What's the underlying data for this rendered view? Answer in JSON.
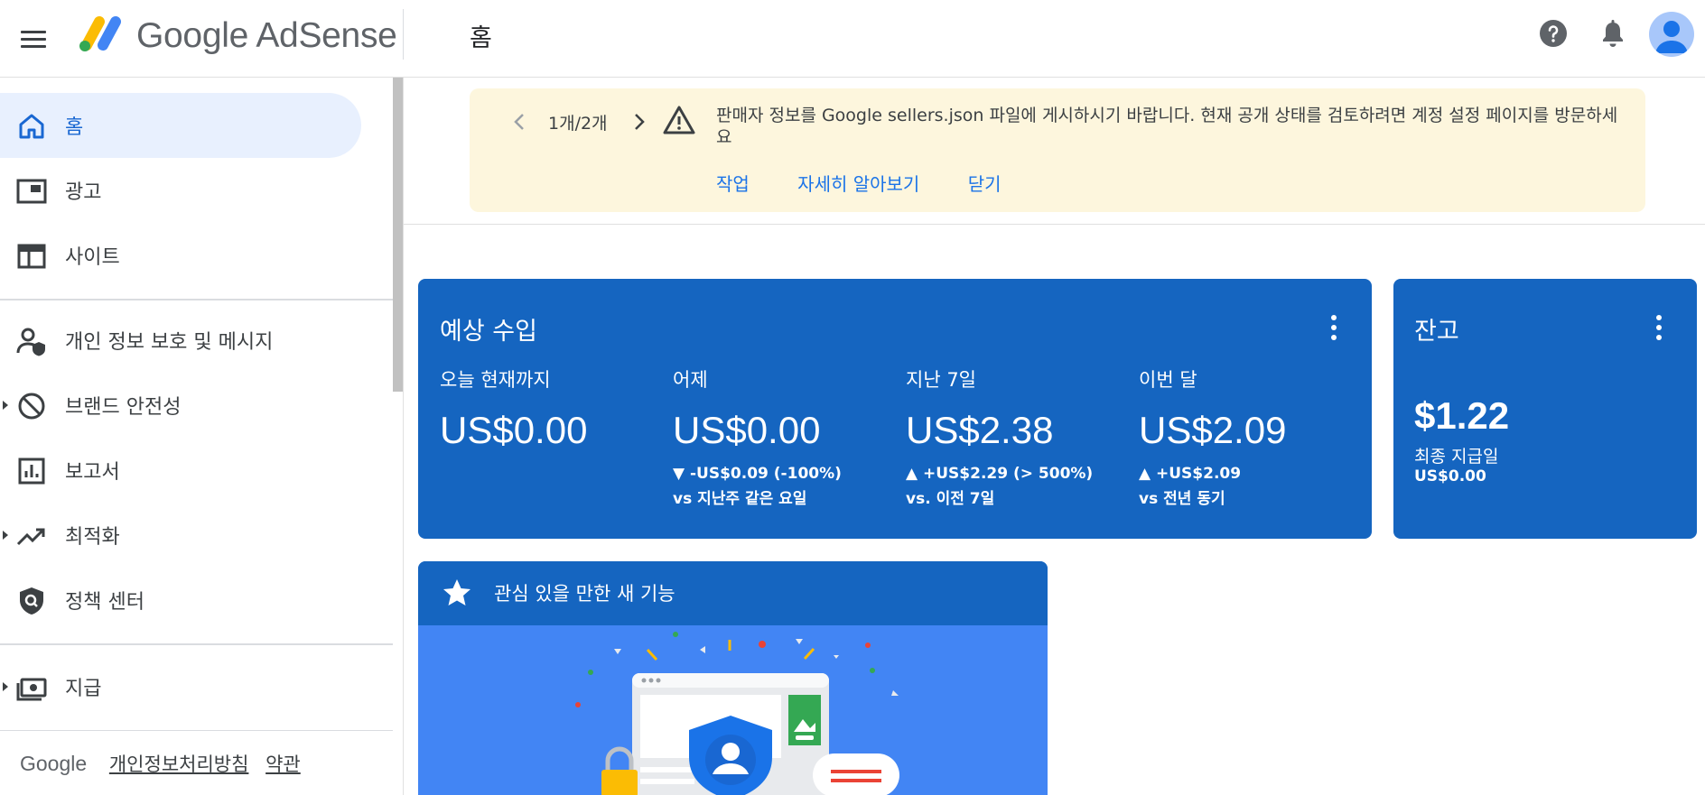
{
  "header": {
    "menu_icon": "menu-icon",
    "logo_text": "Google AdSense",
    "page_title": "홈",
    "help_icon": "help-icon",
    "notifications_icon": "bell-icon",
    "avatar_icon": "account-avatar-icon"
  },
  "sidebar": {
    "items": [
      {
        "label": "홈",
        "icon": "home-icon",
        "active": true
      },
      {
        "label": "광고",
        "icon": "ads-icon"
      },
      {
        "label": "사이트",
        "icon": "sites-icon"
      },
      {
        "label": "개인 정보 보호 및 메시지",
        "icon": "privacy-messaging-icon"
      },
      {
        "label": "브랜드 안전성",
        "icon": "block-icon",
        "expandable": true
      },
      {
        "label": "보고서",
        "icon": "reports-icon"
      },
      {
        "label": "최적화",
        "icon": "trending-up-icon",
        "expandable": true
      },
      {
        "label": "정책 센터",
        "icon": "policy-shield-icon"
      },
      {
        "label": "지급",
        "icon": "payments-icon",
        "expandable": true
      }
    ],
    "footer": {
      "brand": "Google",
      "privacy_link": "개인정보처리방침",
      "terms_link": "약관"
    }
  },
  "banner": {
    "pager": "1개/2개",
    "message": "판매자 정보를 Google sellers.json 파일에 게시하시기 바랍니다. 현재 공개 상태를 검토하려면 계정 설정 페이지를 방문하세요",
    "actions": {
      "act": "작업",
      "learn_more": "자세히 알아보기",
      "dismiss": "닫기"
    },
    "colors": {
      "background": "#fdf6dd",
      "link": "#1a73e8"
    }
  },
  "earnings": {
    "title": "예상 수입",
    "metrics": [
      {
        "label": "오늘 현재까지",
        "value": "US$0.00",
        "change": "",
        "compare": ""
      },
      {
        "label": "어제",
        "value": "US$0.00",
        "change": "▼ -US$0.09 (-100%)",
        "compare": "vs 지난주 같은 요일"
      },
      {
        "label": "지난 7일",
        "value": "US$2.38",
        "change": "▲ +US$2.29 (> 500%)",
        "compare": "vs. 이전 7일"
      },
      {
        "label": "이번 달",
        "value": "US$2.09",
        "change": "▲ +US$2.09",
        "compare": "vs 전년 동기"
      }
    ],
    "color": "#1565c0"
  },
  "balance": {
    "title": "잔고",
    "value": "$1.22",
    "label": "최종 지급일",
    "last_payment": "US$0.00"
  },
  "feature": {
    "title": "관심 있을 만한 새 기능",
    "icon": "star-icon"
  }
}
